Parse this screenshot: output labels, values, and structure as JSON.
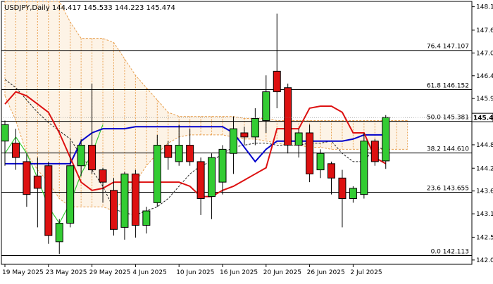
{
  "chart_data": {
    "type": "candlestick",
    "header": {
      "symbol": "USDJPY",
      "timeframe": "Daily",
      "ohlc": "144.417 145.533 144.223 145.474"
    },
    "ylim": [
      141.9,
      148.3
    ],
    "y_ticks": [
      142.005,
      142.56,
      143.13,
      143.685,
      144.24,
      144.81,
      145.474,
      145.935,
      146.49,
      147.045,
      147.6,
      148.17
    ],
    "y_tick_labels": [
      "142.005",
      "142.560",
      "143.130",
      "143.685",
      "144.240",
      "144.810",
      "145.474",
      "145.935",
      "146.490",
      "147.045",
      "147.600",
      "148.170"
    ],
    "current_price": 145.474,
    "current_price_label": "145.474",
    "x_labels": [
      "19 May 2025",
      "23 May 2025",
      "29 May 2025",
      "4 Jun 2025",
      "10 Jun 2025",
      "16 Jun 2025",
      "20 Jun 2025",
      "26 Jun 2025",
      "2 Jul 2025"
    ],
    "x_label_index": [
      0,
      4,
      8,
      12,
      16,
      20,
      24,
      28,
      32
    ],
    "fib_levels": [
      {
        "label": "76.4 147.107",
        "value": 147.107
      },
      {
        "label": "61.8 146.152",
        "value": 146.152
      },
      {
        "label": "50.0 145.381",
        "value": 145.381
      },
      {
        "label": "38.2 144.610",
        "value": 144.61
      },
      {
        "label": "23.6 143.655",
        "value": 143.655
      },
      {
        "label": "0.0 142.113",
        "value": 142.113
      }
    ],
    "candles": [
      {
        "o": 144.9,
        "h": 145.4,
        "l": 144.3,
        "c": 145.3
      },
      {
        "o": 144.85,
        "h": 145.2,
        "l": 144.2,
        "c": 144.5
      },
      {
        "o": 144.4,
        "h": 144.6,
        "l": 143.3,
        "c": 143.6
      },
      {
        "o": 144.05,
        "h": 144.5,
        "l": 142.8,
        "c": 143.75
      },
      {
        "o": 144.3,
        "h": 144.4,
        "l": 142.4,
        "c": 142.6
      },
      {
        "o": 142.45,
        "h": 143.0,
        "l": 142.15,
        "c": 142.9
      },
      {
        "o": 142.9,
        "h": 144.9,
        "l": 142.8,
        "c": 144.3
      },
      {
        "o": 144.3,
        "h": 144.95,
        "l": 144.05,
        "c": 144.8
      },
      {
        "o": 144.8,
        "h": 146.3,
        "l": 144.1,
        "c": 144.2
      },
      {
        "o": 144.2,
        "h": 144.25,
        "l": 143.4,
        "c": 143.9
      },
      {
        "o": 143.7,
        "h": 144.0,
        "l": 142.6,
        "c": 142.75
      },
      {
        "o": 142.8,
        "h": 144.15,
        "l": 142.5,
        "c": 144.1
      },
      {
        "o": 144.1,
        "h": 144.2,
        "l": 142.55,
        "c": 142.85
      },
      {
        "o": 142.85,
        "h": 143.3,
        "l": 142.65,
        "c": 143.2
      },
      {
        "o": 143.4,
        "h": 145.05,
        "l": 143.3,
        "c": 144.8
      },
      {
        "o": 144.8,
        "h": 144.9,
        "l": 144.2,
        "c": 144.5
      },
      {
        "o": 144.4,
        "h": 145.3,
        "l": 144.3,
        "c": 144.8
      },
      {
        "o": 144.8,
        "h": 145.2,
        "l": 144.3,
        "c": 144.4
      },
      {
        "o": 144.4,
        "h": 144.5,
        "l": 143.1,
        "c": 143.5
      },
      {
        "o": 143.55,
        "h": 144.6,
        "l": 143.0,
        "c": 144.5
      },
      {
        "o": 143.9,
        "h": 144.8,
        "l": 143.6,
        "c": 144.7
      },
      {
        "o": 144.6,
        "h": 145.5,
        "l": 144.1,
        "c": 145.2
      },
      {
        "o": 145.1,
        "h": 145.25,
        "l": 144.8,
        "c": 145.0
      },
      {
        "o": 145.0,
        "h": 145.7,
        "l": 144.8,
        "c": 145.45
      },
      {
        "o": 145.4,
        "h": 146.5,
        "l": 145.1,
        "c": 146.1
      },
      {
        "o": 146.6,
        "h": 148.0,
        "l": 145.7,
        "c": 146.1
      },
      {
        "o": 146.2,
        "h": 146.3,
        "l": 144.6,
        "c": 144.8
      },
      {
        "o": 144.8,
        "h": 145.2,
        "l": 144.5,
        "c": 145.1
      },
      {
        "o": 145.1,
        "h": 145.3,
        "l": 143.9,
        "c": 144.1
      },
      {
        "o": 144.2,
        "h": 144.7,
        "l": 144.0,
        "c": 144.6
      },
      {
        "o": 144.35,
        "h": 144.4,
        "l": 143.6,
        "c": 144.0
      },
      {
        "o": 144.0,
        "h": 144.2,
        "l": 142.8,
        "c": 143.5
      },
      {
        "o": 143.5,
        "h": 143.8,
        "l": 143.4,
        "c": 143.75
      },
      {
        "o": 143.6,
        "h": 145.1,
        "l": 143.5,
        "c": 144.9
      },
      {
        "o": 144.9,
        "h": 144.95,
        "l": 144.3,
        "c": 144.4
      },
      {
        "o": 144.417,
        "h": 145.533,
        "l": 144.223,
        "c": 145.474
      }
    ],
    "colors": {
      "bull": "#33cc33",
      "bear": "#dd1111",
      "red_line": "#dd1111",
      "blue_line": "#0000cc",
      "green_line": "#33cc33",
      "black_dashed": "#222222",
      "cloud": "#e8a050",
      "fib_line": "#000000"
    },
    "red_line": [
      [
        0,
        145.8
      ],
      [
        1,
        146.1
      ],
      [
        2,
        146.0
      ],
      [
        3,
        145.8
      ],
      [
        4,
        145.6
      ],
      [
        5,
        145.1
      ],
      [
        6,
        144.5
      ],
      [
        7,
        143.9
      ],
      [
        8,
        143.7
      ],
      [
        9,
        143.75
      ],
      [
        10,
        143.9
      ],
      [
        11,
        143.9
      ],
      [
        12,
        143.9
      ],
      [
        13,
        143.9
      ],
      [
        14,
        143.9
      ],
      [
        15,
        143.9
      ],
      [
        16,
        143.9
      ],
      [
        17,
        143.8
      ],
      [
        18,
        143.55
      ],
      [
        19,
        143.55
      ],
      [
        20,
        143.7
      ],
      [
        21,
        143.8
      ],
      [
        22,
        143.95
      ],
      [
        23,
        144.1
      ],
      [
        24,
        144.25
      ],
      [
        25,
        145.2
      ],
      [
        26,
        145.2
      ],
      [
        27,
        145.2
      ],
      [
        28,
        145.7
      ],
      [
        29,
        145.75
      ],
      [
        30,
        145.75
      ],
      [
        31,
        145.6
      ],
      [
        32,
        145.1
      ],
      [
        33,
        145.1
      ],
      [
        34,
        144.5
      ],
      [
        35,
        144.35
      ]
    ],
    "blue_line": [
      [
        0,
        144.35
      ],
      [
        1,
        144.35
      ],
      [
        2,
        144.35
      ],
      [
        3,
        144.35
      ],
      [
        4,
        144.35
      ],
      [
        5,
        144.35
      ],
      [
        6,
        144.35
      ],
      [
        7,
        144.9
      ],
      [
        8,
        145.1
      ],
      [
        9,
        145.2
      ],
      [
        10,
        145.2
      ],
      [
        11,
        145.2
      ],
      [
        12,
        145.25
      ],
      [
        13,
        145.25
      ],
      [
        14,
        145.25
      ],
      [
        15,
        145.25
      ],
      [
        16,
        145.25
      ],
      [
        17,
        145.25
      ],
      [
        18,
        145.25
      ],
      [
        19,
        145.25
      ],
      [
        20,
        145.25
      ],
      [
        21,
        145.1
      ],
      [
        22,
        144.75
      ],
      [
        23,
        144.4
      ],
      [
        24,
        144.7
      ],
      [
        25,
        144.9
      ],
      [
        26,
        144.9
      ],
      [
        27,
        144.9
      ],
      [
        28,
        144.9
      ],
      [
        29,
        144.9
      ],
      [
        30,
        144.9
      ],
      [
        31,
        144.9
      ],
      [
        32,
        144.95
      ],
      [
        33,
        145.05
      ],
      [
        34,
        145.05
      ],
      [
        35,
        145.05
      ]
    ],
    "green_line": [
      [
        0,
        144.6
      ],
      [
        1,
        145.0
      ],
      [
        2,
        144.6
      ],
      [
        3,
        144.0
      ],
      [
        4,
        143.3
      ],
      [
        5,
        142.9
      ],
      [
        6,
        143.4
      ],
      [
        7,
        144.1
      ],
      [
        8,
        144.6
      ],
      [
        9,
        145.3
      ]
    ],
    "black_dashed": [
      [
        0,
        146.4
      ],
      [
        1,
        146.2
      ],
      [
        2,
        145.9
      ],
      [
        3,
        145.6
      ],
      [
        4,
        145.35
      ],
      [
        5,
        145.15
      ],
      [
        6,
        144.95
      ],
      [
        7,
        144.55
      ],
      [
        8,
        144.2
      ],
      [
        9,
        143.8
      ],
      [
        10,
        143.25
      ],
      [
        11,
        143.15
      ],
      [
        12,
        143.1
      ],
      [
        13,
        143.2
      ],
      [
        14,
        143.3
      ],
      [
        15,
        143.5
      ],
      [
        16,
        143.8
      ],
      [
        17,
        144.1
      ],
      [
        18,
        144.3
      ],
      [
        19,
        144.4
      ],
      [
        20,
        144.6
      ],
      [
        21,
        144.75
      ],
      [
        22,
        144.8
      ],
      [
        23,
        144.85
      ],
      [
        24,
        144.85
      ],
      [
        25,
        144.8
      ],
      [
        26,
        144.8
      ],
      [
        27,
        144.8
      ],
      [
        28,
        144.85
      ],
      [
        29,
        144.85
      ],
      [
        30,
        144.9
      ],
      [
        31,
        144.6
      ],
      [
        32,
        144.4
      ],
      [
        33,
        144.4
      ],
      [
        34,
        144.75
      ],
      [
        35,
        144.7
      ]
    ],
    "cloud_upper": [
      [
        0,
        148.6
      ],
      [
        1,
        148.6
      ],
      [
        2,
        148.6
      ],
      [
        3,
        148.6
      ],
      [
        4,
        148.6
      ],
      [
        5,
        148.3
      ],
      [
        6,
        147.8
      ],
      [
        7,
        147.4
      ],
      [
        8,
        147.4
      ],
      [
        9,
        147.4
      ],
      [
        10,
        147.3
      ],
      [
        11,
        146.9
      ],
      [
        12,
        146.5
      ],
      [
        13,
        146.2
      ],
      [
        14,
        145.9
      ],
      [
        15,
        145.6
      ],
      [
        16,
        145.5
      ],
      [
        17,
        145.5
      ],
      [
        18,
        145.5
      ],
      [
        19,
        145.5
      ],
      [
        20,
        145.5
      ],
      [
        21,
        145.5
      ],
      [
        22,
        145.45
      ],
      [
        23,
        145.45
      ],
      [
        24,
        145.45
      ],
      [
        25,
        145.4
      ],
      [
        26,
        145.4
      ],
      [
        27,
        145.4
      ],
      [
        28,
        145.4
      ],
      [
        29,
        145.4
      ],
      [
        30,
        145.4
      ],
      [
        31,
        145.4
      ],
      [
        32,
        145.4
      ],
      [
        33,
        145.4
      ],
      [
        34,
        145.4
      ],
      [
        35,
        145.4
      ],
      [
        36,
        145.4
      ],
      [
        37,
        145.4
      ]
    ],
    "cloud_lower": [
      [
        0,
        146.0
      ],
      [
        1,
        145.4
      ],
      [
        2,
        144.6
      ],
      [
        3,
        144.2
      ],
      [
        4,
        143.9
      ],
      [
        5,
        143.5
      ],
      [
        6,
        143.3
      ],
      [
        7,
        143.3
      ],
      [
        8,
        143.3
      ],
      [
        9,
        143.3
      ],
      [
        10,
        143.2
      ],
      [
        11,
        143.5
      ],
      [
        12,
        143.9
      ],
      [
        13,
        144.3
      ],
      [
        14,
        144.6
      ],
      [
        15,
        144.85
      ],
      [
        16,
        145.0
      ],
      [
        17,
        145.05
      ],
      [
        18,
        145.05
      ],
      [
        19,
        145.05
      ],
      [
        20,
        145.05
      ],
      [
        21,
        145.0
      ],
      [
        22,
        144.95
      ],
      [
        23,
        144.95
      ],
      [
        24,
        144.9
      ],
      [
        25,
        144.85
      ],
      [
        26,
        144.8
      ],
      [
        27,
        144.8
      ],
      [
        28,
        144.75
      ],
      [
        29,
        144.75
      ],
      [
        30,
        144.7
      ],
      [
        31,
        144.7
      ],
      [
        32,
        144.7
      ],
      [
        33,
        144.7
      ],
      [
        34,
        144.7
      ],
      [
        35,
        144.7
      ],
      [
        36,
        144.7
      ],
      [
        37,
        144.7
      ]
    ]
  }
}
